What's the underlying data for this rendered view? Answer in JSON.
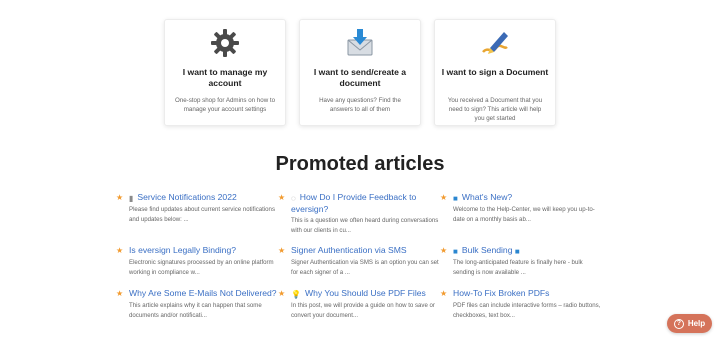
{
  "cards": [
    {
      "icon": "gear-icon",
      "title": "I want to manage my account",
      "desc": "One-stop shop for Admins on how to manage your account settings"
    },
    {
      "icon": "envelope-download-icon",
      "title": "I want to send/create a document",
      "desc": "Have any questions? Find the answers to all of them"
    },
    {
      "icon": "signature-pen-icon",
      "title": "I want to sign a Document",
      "desc": "You received a Document that you need to sign? This article will help you get started"
    }
  ],
  "section_title": "Promoted articles",
  "articles": [
    {
      "prefix": "▮",
      "title": "Service Notifications 2022",
      "desc": "Please find updates about current service notifications and updates below: ..."
    },
    {
      "prefix": "◌",
      "title": "How Do I Provide Feedback to eversign?",
      "desc": "This is a question we often heard during conversations with our clients in cu..."
    },
    {
      "prefix": "■",
      "title": "What's New?",
      "desc": "Welcome to the Help-Center, we will keep you up-to-date on a monthly basis ab..."
    },
    {
      "prefix": "",
      "title": "Is eversign Legally Binding?",
      "desc": "Electronic signatures processed by an online platform working in compliance w..."
    },
    {
      "prefix": "",
      "title": "Signer Authentication via SMS",
      "desc": "Signer Authentication via SMS is an option you can set for each signer of a ..."
    },
    {
      "prefix": "■",
      "title": "Bulk Sending",
      "suffix": "■",
      "desc": "The long-anticipated feature is finally here - bulk sending is now available ..."
    },
    {
      "prefix": "",
      "title": "Why Are Some E-Mails Not Delivered?",
      "desc": "This article explains why it can happen that some documents and/or notificati..."
    },
    {
      "prefix": "💡",
      "title": "Why You Should Use PDF Files",
      "desc": "In this post, we will provide a guide on how to save or convert your document..."
    },
    {
      "prefix": "",
      "title": "How-To Fix Broken PDFs",
      "desc": "PDF files can include interactive forms – radio buttons, checkboxes, text box..."
    }
  ],
  "help_button": {
    "label": "Help",
    "icon": "question-circle-icon"
  },
  "colors": {
    "accent": "#3a6fc4",
    "star": "#f29a2e",
    "help": "#d5735a"
  }
}
